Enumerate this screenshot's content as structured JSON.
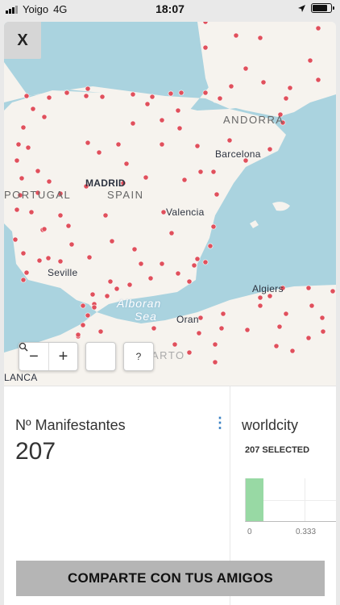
{
  "status_bar": {
    "carrier": "Yoigo",
    "network": "4G",
    "time": "18:07",
    "battery_level": 0.8
  },
  "close_label": "X",
  "map": {
    "labels": {
      "andorra": "ANDORRA",
      "barcelona": "Barcelona",
      "madrid": "MADRID",
      "spain": "SPAIN",
      "portugal": "PORTUGAL",
      "valencia": "Valencia",
      "seville": "Seville",
      "algiers": "Algiers",
      "alboran": "Alboran",
      "sea": "Sea",
      "oran": "Oran",
      "casablanca": "LANCA",
      "morocco": "ARTO"
    },
    "controls": {
      "zoom_out": "−",
      "zoom_in": "+",
      "search": "🔍",
      "help": "?"
    },
    "colors": {
      "water": "#aad3df",
      "land": "#f6f3ee",
      "marker": "#e0505c"
    }
  },
  "metric": {
    "title": "Nº Manifestantes",
    "value": "207",
    "menu_icon": "⋮"
  },
  "worldcity": {
    "title": "worldcity",
    "selected": "207 SELECTED",
    "bar_value": 0.07,
    "ticks": [
      "0",
      "0.333"
    ],
    "bar_color": "#98d9a4"
  },
  "share_button": "COMPARTE CON TUS AMIGOS"
}
